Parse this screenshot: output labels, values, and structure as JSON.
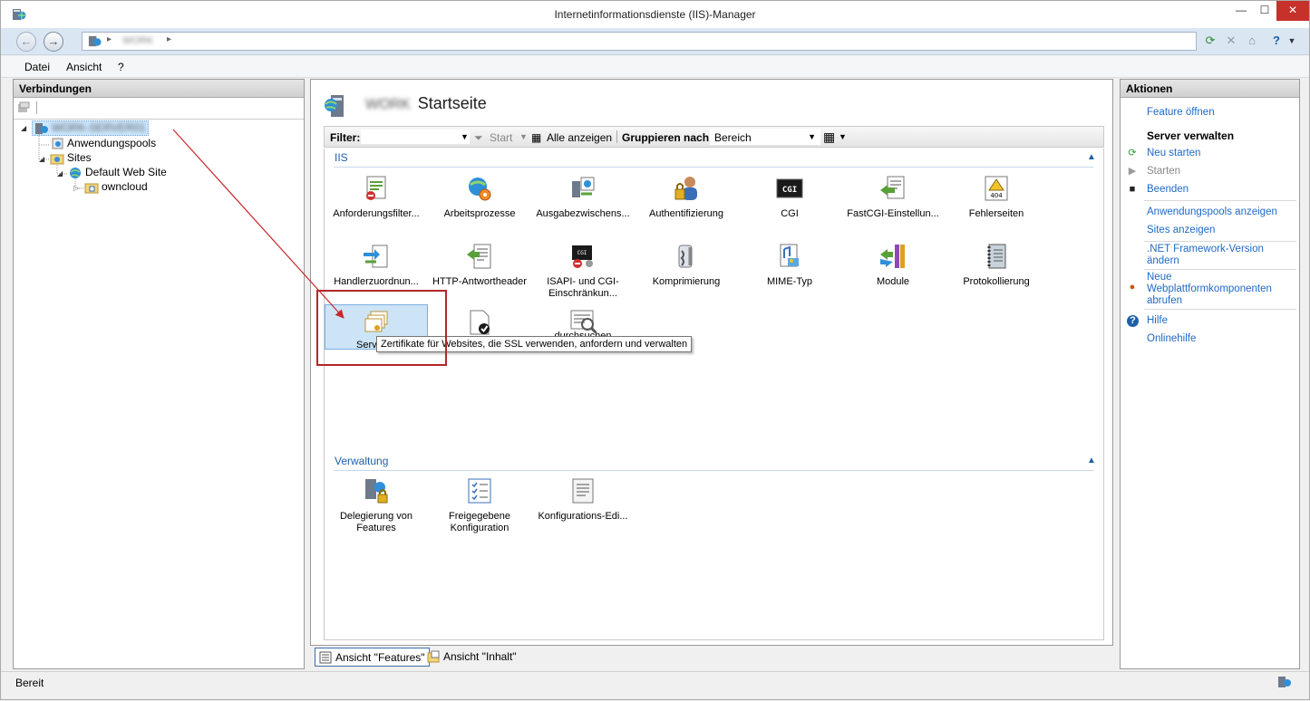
{
  "window": {
    "title": "Internetinformationsdienste (IIS)-Manager",
    "minimize": "—",
    "maximize": "☐",
    "close": "✕"
  },
  "address": {
    "back": "←",
    "forward": "→",
    "crumb_server": "WORK",
    "sep": "▸"
  },
  "menu": {
    "file": "Datei",
    "view": "Ansicht",
    "help": "?"
  },
  "connections": {
    "header": "Verbindungen",
    "server": "WORK-SERVER01",
    "app_pools": "Anwendungspools",
    "sites": "Sites",
    "default_site": "Default Web Site",
    "owncloud": "owncloud"
  },
  "main": {
    "server_name": "WORK",
    "title": "Startseite",
    "filter_label": "Filter:",
    "start": "Start",
    "show_all": "Alle anzeigen",
    "group_by": "Gruppieren nach:",
    "group_value": "Bereich",
    "group_iis": "IIS",
    "group_mgmt": "Verwaltung",
    "features_iis": [
      {
        "label": "Anforderungsfilter...",
        "icon": "request-filtering-icon"
      },
      {
        "label": "Arbeitsprozesse",
        "icon": "worker-processes-icon"
      },
      {
        "label": "Ausgabezwischens...",
        "icon": "output-caching-icon"
      },
      {
        "label": "Authentifizierung",
        "icon": "authentication-icon"
      },
      {
        "label": "CGI",
        "icon": "cgi-icon"
      },
      {
        "label": "FastCGI-Einstellun...",
        "icon": "fastcgi-icon"
      },
      {
        "label": "Fehlerseiten",
        "icon": "error-pages-icon"
      },
      {
        "label": "Handlerzuordnun...",
        "icon": "handler-mappings-icon"
      },
      {
        "label": "HTTP-Antwortheader",
        "icon": "http-headers-icon"
      },
      {
        "label": "ISAPI- und CGI-Einschränkun...",
        "icon": "isapi-cgi-icon"
      },
      {
        "label": "Komprimierung",
        "icon": "compression-icon"
      },
      {
        "label": "MIME-Typ",
        "icon": "mime-types-icon"
      },
      {
        "label": "Module",
        "icon": "modules-icon"
      },
      {
        "label": "Protokollierung",
        "icon": "logging-icon"
      },
      {
        "label": "Serverze",
        "icon": "server-certificates-icon"
      },
      {
        "label": "",
        "icon": "default-document-icon"
      },
      {
        "label": "durchsuchen",
        "icon": "directory-browsing-icon"
      }
    ],
    "features_mgmt": [
      {
        "label": "Delegierung von Features",
        "icon": "feature-delegation-icon"
      },
      {
        "label": "Freigegebene Konfiguration",
        "icon": "shared-configuration-icon"
      },
      {
        "label": "Konfigurations-Edi...",
        "icon": "configuration-editor-icon"
      }
    ],
    "tooltip": "Zertifikate für Websites, die SSL verwenden, anfordern und verwalten"
  },
  "tabs": {
    "features_view": "Ansicht \"Features\"",
    "content_view": "Ansicht \"Inhalt\""
  },
  "actions": {
    "header": "Aktionen",
    "open_feature": "Feature öffnen",
    "manage_server": "Server verwalten",
    "restart": "Neu starten",
    "start": "Starten",
    "stop": "Beenden",
    "view_app_pools": "Anwendungspools anzeigen",
    "view_sites": "Sites anzeigen",
    "netfx": ".NET Framework-Version ändern",
    "webpi": "Neue Webplattformkomponenten abrufen",
    "help": "Hilfe",
    "online_help": "Onlinehilfe"
  },
  "status": {
    "text": "Bereit"
  },
  "colors": {
    "link": "#1e6ac8",
    "group": "#1e5fa8",
    "highlight": "#b3262a",
    "close": "#c7312b"
  }
}
